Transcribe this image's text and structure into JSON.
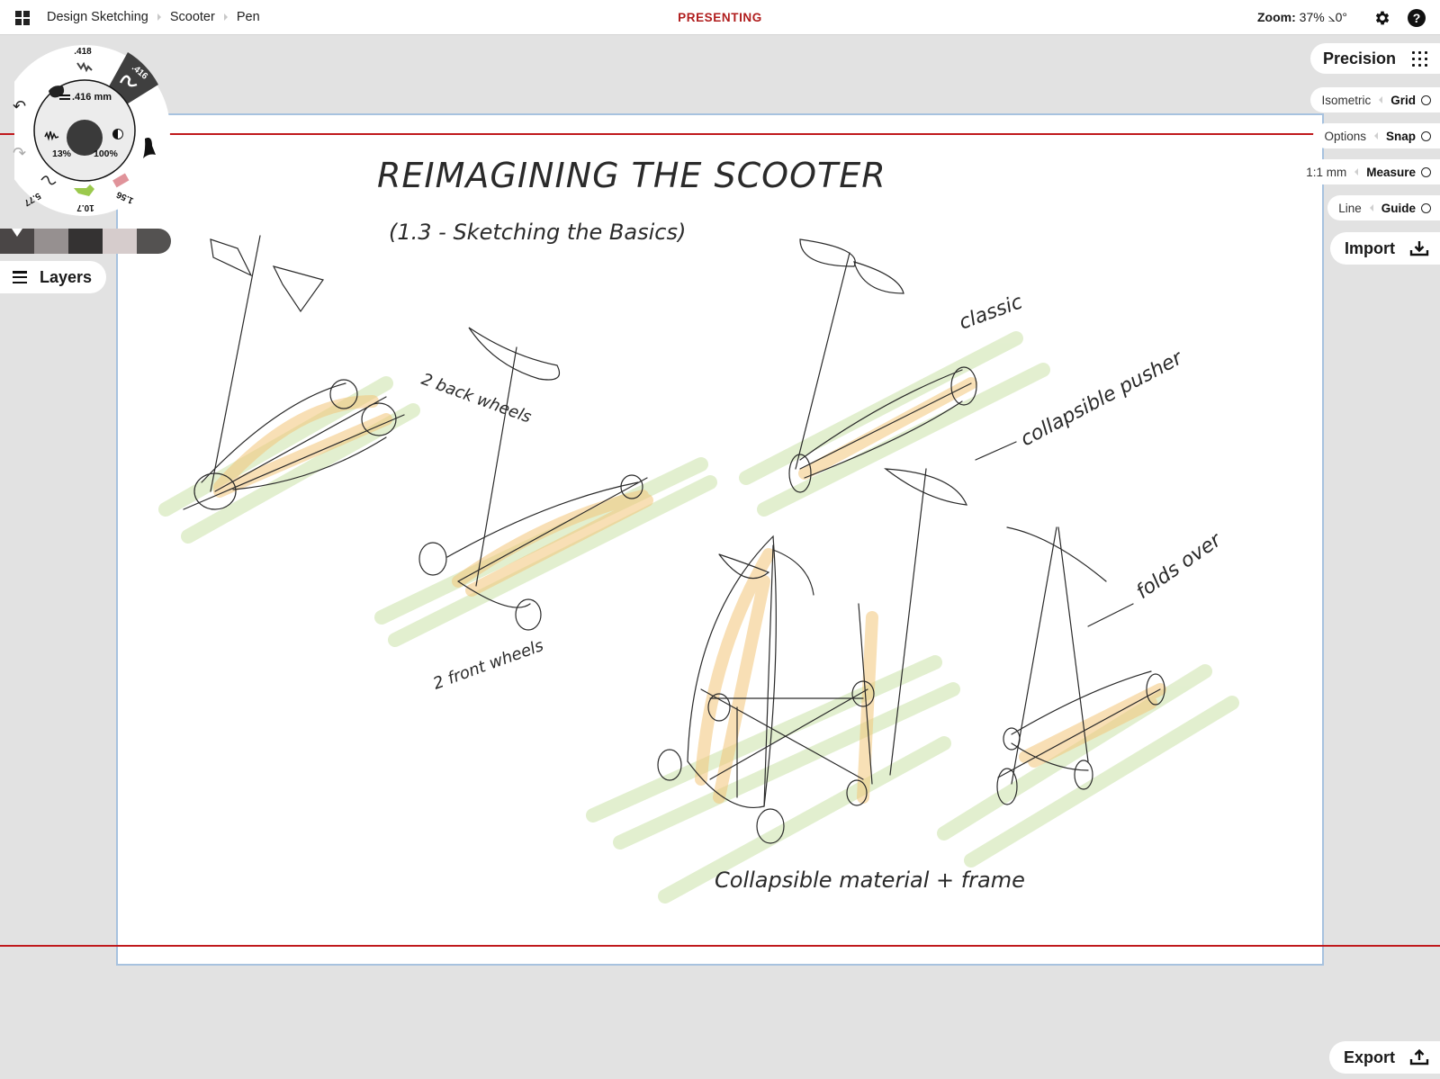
{
  "topbar": {
    "apps_icon": "grid-apps-icon",
    "breadcrumbs": [
      "Design Sketching",
      "Scooter",
      "Pen"
    ],
    "mode": "PRESENTING",
    "zoom_label": "Zoom:",
    "zoom_value": "37%",
    "rotation": "⦣0°",
    "settings_icon": "gear-icon",
    "help_icon": "help-icon"
  },
  "brush_wheel": {
    "size_readout": ".416 mm",
    "opacity": "13%",
    "contrast": "100%",
    "tools": [
      {
        "name": "marker",
        "value": "",
        "active": false
      },
      {
        "name": "pencil",
        "value": ".418",
        "active": false
      },
      {
        "name": "pen",
        "value": ".416",
        "active": true
      },
      {
        "name": "brush",
        "value": "",
        "active": false
      },
      {
        "name": "eraser",
        "value": "1.56",
        "active": false
      },
      {
        "name": "highlighter",
        "value": "10.7",
        "active": false
      },
      {
        "name": "wire-pen",
        "value": "5.77",
        "active": false
      }
    ],
    "undo_icon": "undo-icon",
    "redo_icon": "redo-icon"
  },
  "color_swatches": {
    "colors": [
      "#4a4646",
      "#969090",
      "#343232",
      "#d6cccc",
      "#545251"
    ],
    "active_index": 0
  },
  "layers": {
    "label": "Layers"
  },
  "precision": {
    "label": "Precision",
    "toggles": [
      {
        "option": "Isometric",
        "name": "Grid",
        "on": false
      },
      {
        "option": "Options",
        "name": "Snap",
        "on": false
      },
      {
        "option": "1:1 mm",
        "name": "Measure",
        "on": false
      },
      {
        "option": "Line",
        "name": "Guide",
        "on": false
      }
    ]
  },
  "import": {
    "label": "Import"
  },
  "export": {
    "label": "Export"
  },
  "canvas": {
    "accent_guide_color": "#c0191c",
    "paper_border_color": "#a7c2df",
    "handwriting": {
      "title": "REIMAGINING THE SCOOTER",
      "subtitle": "(1.3 - Sketching the Basics)",
      "notes": [
        "2 back wheels",
        "2 front wheels",
        "classic",
        "collapsible pusher",
        "folds over",
        "Collapsible material + frame"
      ]
    }
  }
}
